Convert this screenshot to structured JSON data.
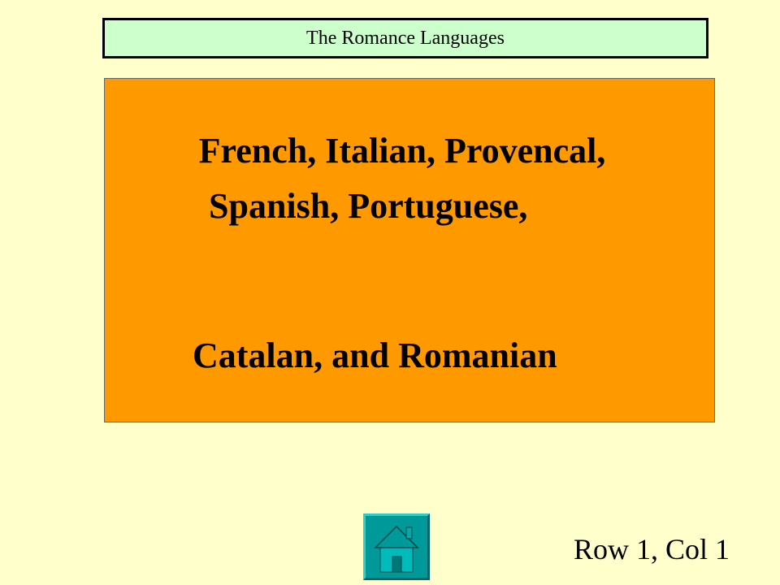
{
  "header": {
    "category": "The Romance Languages"
  },
  "answer": {
    "lines": [
      "French, Italian, Provencal,",
      "Spanish, Portuguese,",
      "Catalan, and Romanian"
    ]
  },
  "footer": {
    "cell_label": "Row 1, Col 1"
  },
  "icons": {
    "home": "home-icon"
  },
  "colors": {
    "background": "#ffffcc",
    "category_bar": "#ccffcc",
    "answer_card": "#ff9900",
    "home_button": "#009999"
  }
}
